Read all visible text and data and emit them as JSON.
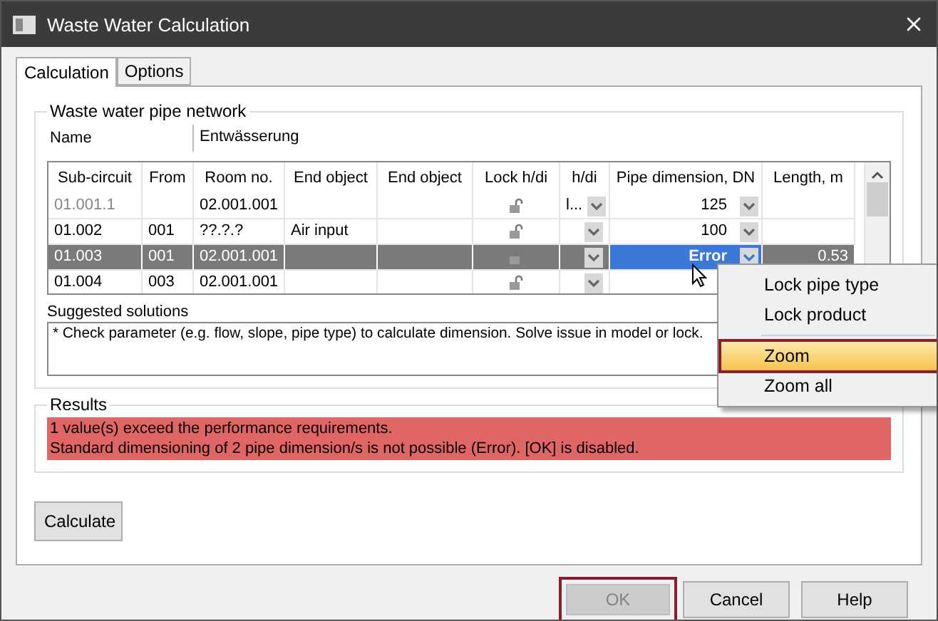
{
  "window": {
    "title": "Waste Water Calculation"
  },
  "tabs": [
    {
      "label": "Calculation",
      "selected": true
    },
    {
      "label": "Options",
      "selected": false
    }
  ],
  "network": {
    "legend": "Waste water pipe network",
    "name_label": "Name",
    "name_value": "Entwässerung",
    "columns": [
      "Sub-circuit",
      "From",
      "Room no.",
      "End object",
      "End object",
      "Lock h/di",
      "h/di",
      "Pipe dimension, DN",
      "Length, m"
    ],
    "rows": [
      {
        "cells": [
          "01.001.1",
          "",
          "02.001.001",
          "",
          ""
        ],
        "greyed": true,
        "selected": false,
        "error": false,
        "hdi": "l...",
        "dimension": "125",
        "length": ""
      },
      {
        "cells": [
          "01.002",
          "001",
          "??.?.?",
          "Air input",
          ""
        ],
        "greyed": false,
        "selected": false,
        "error": false,
        "hdi": "",
        "dimension": "100",
        "length": ""
      },
      {
        "cells": [
          "01.003",
          "001",
          "02.001.001",
          "",
          ""
        ],
        "greyed": false,
        "selected": true,
        "error": true,
        "hdi": "",
        "dimension": "Error",
        "length": "0.53"
      },
      {
        "cells": [
          "01.004",
          "003",
          "02.001.001",
          "",
          ""
        ],
        "greyed": false,
        "selected": false,
        "error": false,
        "hdi": "",
        "dimension": "",
        "length": ""
      }
    ]
  },
  "suggested": {
    "label": "Suggested solutions",
    "text": "* Check parameter (e.g. flow, slope, pipe type) to calculate dimension. Solve issue in model or lock."
  },
  "results": {
    "legend": "Results",
    "error": true,
    "messages": [
      "1 value(s) exceed the performance requirements.",
      "Standard dimensioning of 2 pipe dimension/s is not possible (Error). [OK] is disabled."
    ]
  },
  "calculate": "Calculate",
  "buttons": [
    {
      "label": "OK",
      "disabled": true,
      "highlighted": true
    },
    {
      "label": "Cancel",
      "disabled": false,
      "highlighted": false
    },
    {
      "label": "Help",
      "disabled": false,
      "highlighted": false
    }
  ],
  "context_menu": [
    {
      "kind": "item",
      "label": "Lock pipe type",
      "selected": false
    },
    {
      "kind": "item",
      "label": "Lock product",
      "selected": false
    },
    {
      "kind": "separator"
    },
    {
      "kind": "item",
      "label": "Zoom",
      "selected": true
    },
    {
      "kind": "item",
      "label": "Zoom all",
      "selected": false
    }
  ]
}
